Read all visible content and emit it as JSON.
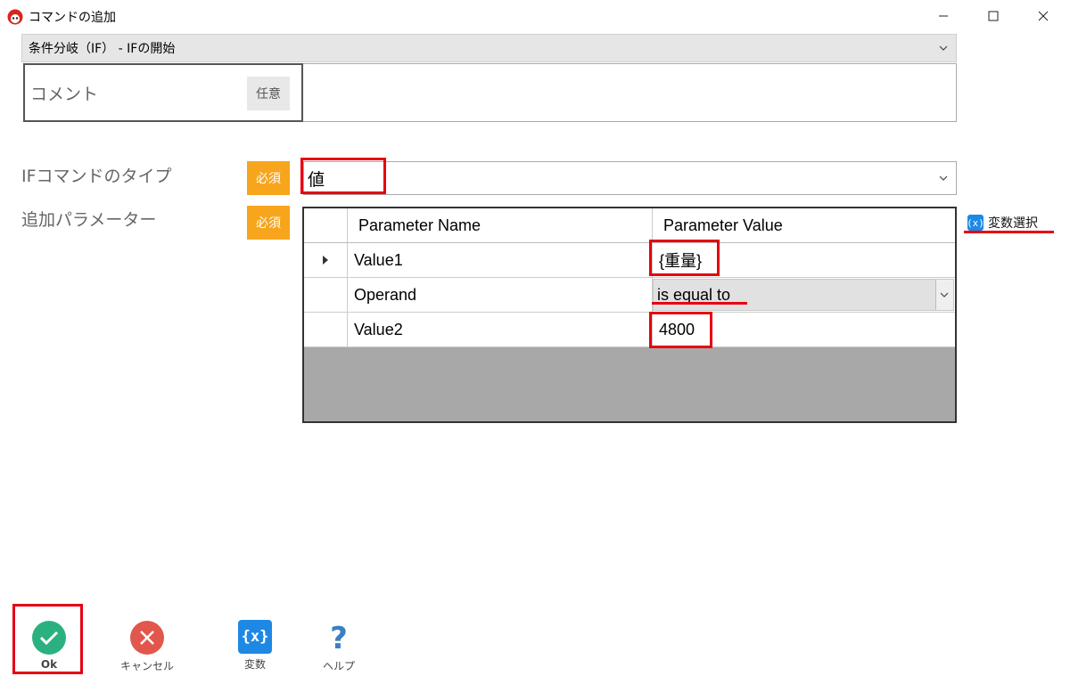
{
  "window": {
    "title": "コマンドの追加"
  },
  "command_select": {
    "value": "条件分岐（IF） - IFの開始"
  },
  "comment": {
    "label": "コメント",
    "badge": "任意",
    "value": ""
  },
  "if_type": {
    "label": "IFコマンドのタイプ",
    "badge": "必須",
    "value": "値"
  },
  "params": {
    "label": "追加パラメーター",
    "badge": "必須",
    "columns": [
      "Parameter Name",
      "Parameter Value"
    ],
    "rows": [
      {
        "name": "Value1",
        "value": "{重量}"
      },
      {
        "name": "Operand",
        "value": "is equal to"
      },
      {
        "name": "Value2",
        "value": "4800"
      }
    ]
  },
  "var_select": {
    "icon_text": "(x)",
    "label": "変数選択"
  },
  "footer": {
    "ok": "Ok",
    "cancel": "キャンセル",
    "variables": "変数",
    "variables_icon_text": "{x}",
    "help": "ヘルプ"
  },
  "colors": {
    "required_badge": "#f7a51c",
    "optional_badge": "#e8e8e8",
    "highlight": "#e60012",
    "ok": "#2bb17f",
    "cancel": "#e2574c",
    "variables": "#1e88e5",
    "help": "#3b7fc4"
  },
  "icons": [
    "app-icon",
    "minimize-icon",
    "maximize-icon",
    "close-icon",
    "chevron-down-icon",
    "row-selector-icon",
    "variable-icon",
    "check-icon",
    "cancel-icon",
    "variables-icon",
    "help-icon"
  ]
}
